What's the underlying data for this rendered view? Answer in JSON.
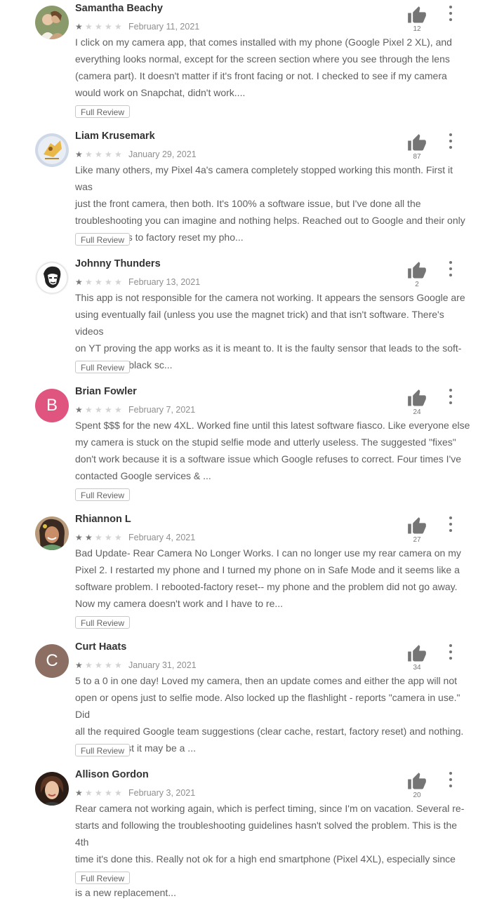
{
  "reviews": [
    {
      "name": "Samantha Beachy",
      "rating": 1,
      "date": "February 11, 2021",
      "text": "I click on my camera app, that comes installed with my phone (Google Pixel 2 XL), and\neverything looks normal, except for the screen section where you see through the lens\n(camera part). It doesn't matter if it's front facing or not. I checked to see if my camera\nwould work on Snapchat, didn't work....",
      "helpful_count": "12",
      "full_review_label": "Full Review"
    },
    {
      "name": "Liam Krusemark",
      "rating": 1,
      "date": "January 29, 2021",
      "text": "Like many others, my Pixel 4a's camera completely stopped working this month. First it was\njust the front camera, then both. It's 100% a software issue, but I've done all the\ntroubleshooting you can imagine and nothing helps. Reached out to Google and their only\nsuggestion is to factory reset my pho...",
      "helpful_count": "87",
      "full_review_label": "Full Review"
    },
    {
      "name": "Johnny Thunders",
      "rating": 1,
      "date": "February 13, 2021",
      "text": "This app is not responsible for the camera not working. It appears the sensors Google are\nusing eventually fail (unless you use the magnet trick) and that isn't software. There's videos\non YT proving the app works as it is meant to. It is the faulty sensor that leads to the soft-\nware failure/black sc...",
      "helpful_count": "2",
      "full_review_label": "Full Review"
    },
    {
      "name": "Brian Fowler",
      "rating": 1,
      "date": "February 7, 2021",
      "avatar_letter": "B",
      "avatar_color": "#e0557f",
      "text": "Spent $$$ for the new 4XL. Worked fine until this latest software fiasco. Like everyone else\nmy camera is stuck on the stupid selfie mode and utterly useless. The suggested \"fixes\"\ndon't work because it is a software issue which Google refuses to correct. Four times I've\ncontacted Google services & ...",
      "helpful_count": "24",
      "full_review_label": "Full Review"
    },
    {
      "name": "Rhiannon L",
      "rating": 2,
      "date": "February 4, 2021",
      "text": "Bad Update- Rear Camera No Longer Works. I can no longer use my rear camera on my\nPixel 2. I restarted my phone and I turned my phone on in Safe Mode and it seems like a\nsoftware problem. I rebooted-factory reset-- my phone and the problem did not go away.\nNow my camera doesn't work and I have to re...",
      "helpful_count": "27",
      "full_review_label": "Full Review"
    },
    {
      "name": "Curt Haats",
      "rating": 1,
      "date": "January 31, 2021",
      "avatar_letter": "C",
      "avatar_color": "#8d6e63",
      "text": "5 to a 0 in one day! Loved my camera, then an update comes and either the app will not\nopen or opens just to selfie mode. Also locked up the flashlight - reports \"camera in use.\" Did\nall the required Google team suggestions (clear cache, restart, factory reset) and nothing.\nThey suggest it may be a ...",
      "helpful_count": "34",
      "full_review_label": "Full Review"
    },
    {
      "name": "Allison Gordon",
      "rating": 1,
      "date": "February 3, 2021",
      "text": "Rear camera not working again, which is perfect timing, since I'm on vacation. Several re-\nstarts and following the troubleshooting guidelines hasn't solved the problem. This is the 4th\ntime it's done this. Really not ok for a high end smartphone (Pixel 4XL), especially since this\nis a new replacement...",
      "helpful_count": "20",
      "full_review_label": "Full Review"
    }
  ]
}
